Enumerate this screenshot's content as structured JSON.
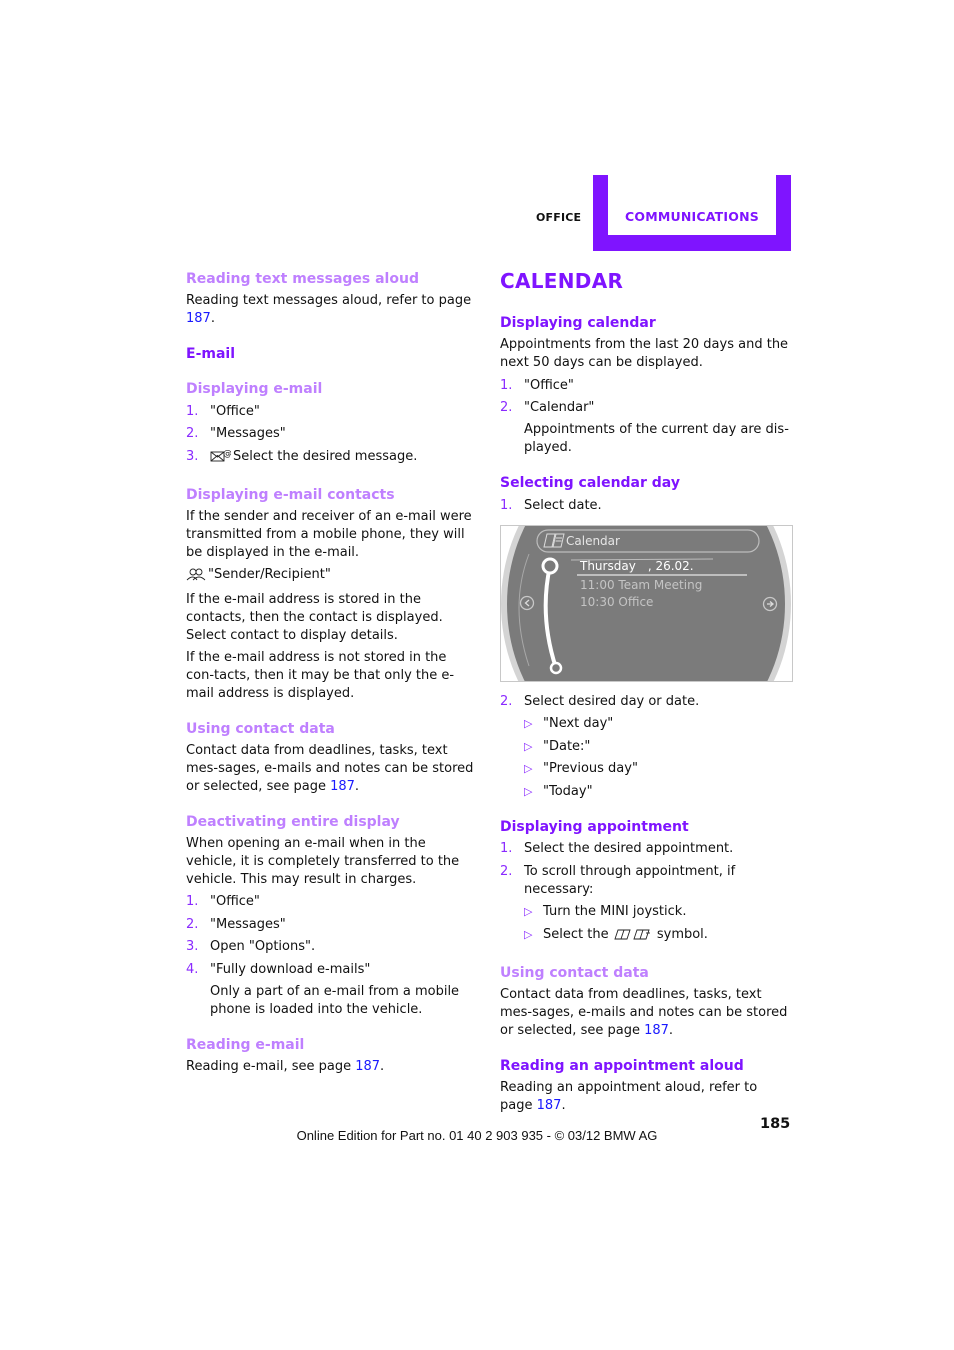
{
  "header": {
    "section": "OFFICE",
    "chapter": "COMMUNICATIONS",
    "accent_color": "#7f14ff"
  },
  "left": {
    "s1": {
      "title": "Reading text messages aloud",
      "text": "Reading text messages aloud, refer to page ",
      "page": "187",
      "end": "."
    },
    "email_title": "E-mail",
    "s2": {
      "title": "Displaying e-mail",
      "steps": [
        {
          "num": "1.",
          "text": "\"Office\""
        },
        {
          "num": "2.",
          "text": "\"Messages\""
        },
        {
          "num": "3.",
          "icon": "envelope-at-icon",
          "text": "Select the desired message."
        }
      ]
    },
    "s3": {
      "title": "Displaying e-mail contacts",
      "p1": "If the sender and receiver of an e-mail were transmitted from a mobile phone, they will be displayed in the e-mail.",
      "icon": "contacts-icon",
      "menu_item": "\"Sender/Recipient\"",
      "p2": "If the e-mail address is stored in the contacts, then the contact is displayed. Select contact to display details.",
      "p3": "If the e-mail address is not stored in the con-tacts, then it may be that only the e-mail address is displayed."
    },
    "s4": {
      "title": "Using contact data",
      "text": "Contact data from deadlines, tasks, text mes-sages, e-mails and notes can be stored or selected, see page ",
      "page": "187",
      "end": "."
    },
    "s5": {
      "title": "Deactivating entire display",
      "p1": "When opening an e-mail when in the vehicle, it is completely transferred to the vehicle. This may result in charges.",
      "steps": [
        {
          "num": "1.",
          "text": "\"Office\""
        },
        {
          "num": "2.",
          "text": "\"Messages\""
        },
        {
          "num": "3.",
          "text": "Open \"Options\"."
        },
        {
          "num": "4.",
          "text": "\"Fully download e-mails\""
        }
      ],
      "note": "Only a part of an e-mail from a mobile phone is loaded into the vehicle."
    },
    "s6": {
      "title": "Reading e-mail",
      "text": "Reading e-mail, see page ",
      "page": "187",
      "end": "."
    }
  },
  "right": {
    "title": "CALENDAR",
    "s1": {
      "title": "Displaying calendar",
      "p1": "Appointments from the last 20 days and the next 50 days can be displayed.",
      "steps": [
        {
          "num": "1.",
          "text": "\"Office\""
        },
        {
          "num": "2.",
          "text": "\"Calendar\""
        }
      ],
      "note": "Appointments of the current day are dis-played."
    },
    "s2": {
      "title": "Selecting calendar day",
      "step1": {
        "num": "1.",
        "text": "Select date."
      },
      "screen": {
        "title": "Calendar",
        "day": "Thursday",
        "date": ", 26.02.",
        "appointments": [
          "11:00 Team Meeting",
          "10:30 Office"
        ]
      },
      "step2": {
        "num": "2.",
        "text": "Select desired day or date."
      },
      "options": [
        "\"Next day\"",
        "\"Date:\"",
        "\"Previous day\"",
        "\"Today\""
      ]
    },
    "s3": {
      "title": "Displaying appointment",
      "steps": [
        {
          "num": "1.",
          "text": "Select the desired appointment."
        },
        {
          "num": "2.",
          "text": "To scroll through appointment, if necessary:"
        }
      ],
      "bullets": [
        {
          "text": "Turn the MINI joystick."
        },
        {
          "pre": "Select the ",
          "icon": "page-scroll-icon",
          "post": " symbol."
        }
      ]
    },
    "s4": {
      "title": "Using contact data",
      "text": "Contact data from deadlines, tasks, text mes-sages, e-mails and notes can be stored or selected, see page ",
      "page": "187",
      "end": "."
    },
    "s5": {
      "title": "Reading an appointment aloud",
      "text": "Reading an appointment aloud, refer to page ",
      "page": "187",
      "end": "."
    }
  },
  "footer": {
    "edition": "Online Edition for Part no. 01 40 2 903 935 - © 03/12 BMW AG",
    "page_number": "185"
  }
}
